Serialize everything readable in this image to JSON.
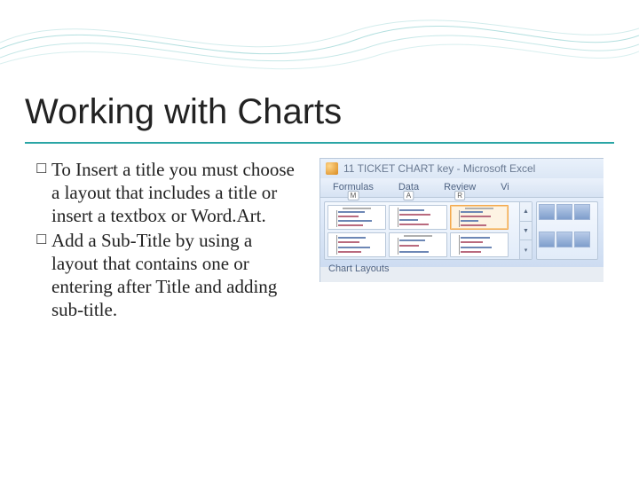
{
  "slide": {
    "title": "Working with Charts",
    "bullets": [
      "To Insert a title you must choose a layout that includes a title or insert a textbox or Word.Art.",
      "Add a Sub-Title by using a layout that contains one or entering after Title and adding sub-title."
    ]
  },
  "excel": {
    "window_title": "11 TICKET CHART key - Microsoft Excel",
    "tabs": [
      {
        "label": "Formulas",
        "key": "M"
      },
      {
        "label": "Data",
        "key": "A"
      },
      {
        "label": "Review",
        "key": "R"
      },
      {
        "label": "Vi",
        "key": ""
      }
    ],
    "ribbon_group_label": "Chart Layouts"
  }
}
